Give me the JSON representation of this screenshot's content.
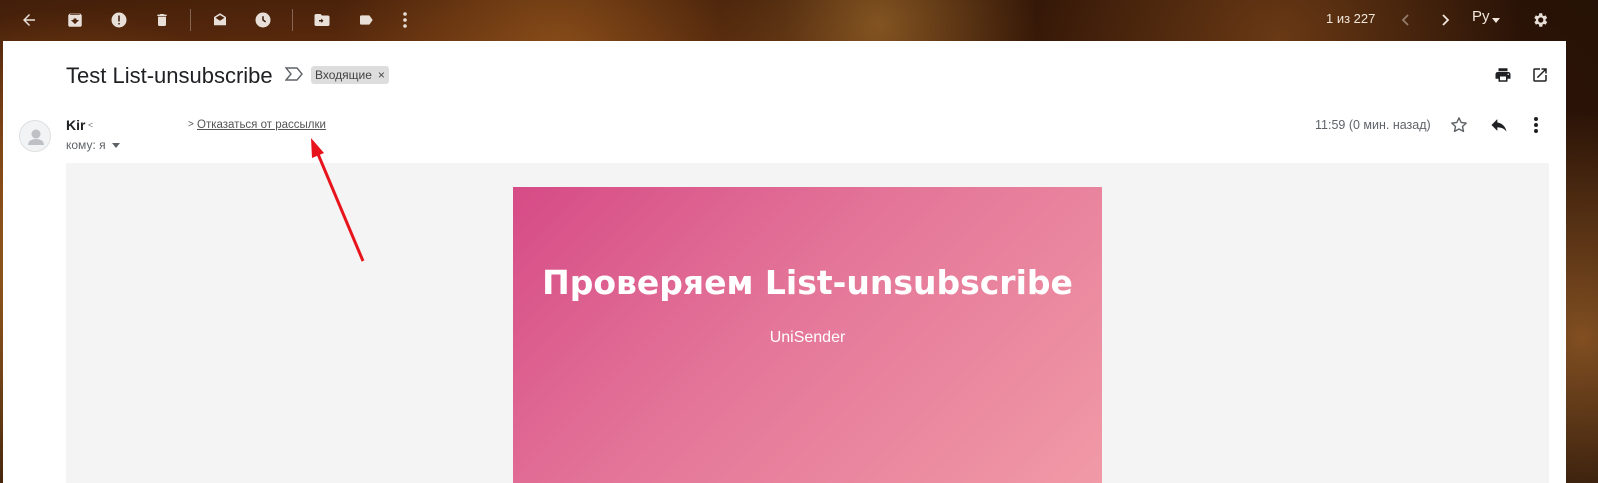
{
  "toolbar": {
    "icons": [
      "back-arrow-icon",
      "archive-icon",
      "spam-icon",
      "delete-icon",
      "mark-unread-icon",
      "snooze-icon",
      "move-to-icon",
      "label-icon",
      "more-vert-icon"
    ],
    "pagination": "1 из 227",
    "language": "Ру"
  },
  "message": {
    "subject": "Test List-unsubscribe",
    "label_chip": "Входящие",
    "label_close": "×",
    "sender_name": "Kir",
    "sender_email_marker": "<",
    "unsubscribe_prefix": ">",
    "unsubscribe_link": "Отказаться от рассылки",
    "to_line": "кому: я",
    "time": "11:59 (0 мин. назад)"
  },
  "email_body": {
    "hero_title": "Проверяем List-unsubscribe",
    "hero_subtitle": "UniSender"
  },
  "colors": {
    "hero_start": "#d64b86",
    "hero_end": "#f19aa6",
    "annotation_arrow": "#e8141c",
    "body_bg": "#f4f4f4"
  }
}
